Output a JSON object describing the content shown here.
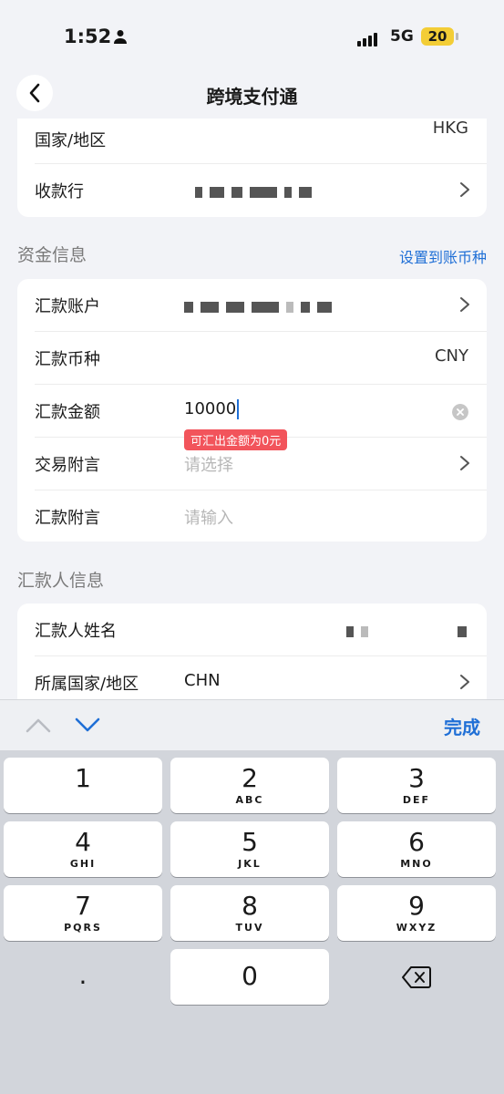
{
  "status": {
    "time": "1:52",
    "network": "5G",
    "battery": "20"
  },
  "nav": {
    "title": "跨境支付通"
  },
  "payee": {
    "country_label": "国家/地区",
    "country_value": "HKG",
    "bank_label": "收款行"
  },
  "funds": {
    "section_title": "资金信息",
    "section_link": "设置到账币种",
    "account_label": "汇款账户",
    "currency_label": "汇款币种",
    "currency_value": "CNY",
    "amount_label": "汇款金额",
    "amount_value": "10000",
    "amount_error": "可汇出金额为0元",
    "memo_label": "交易附言",
    "memo_placeholder": "请选择",
    "remark_label": "汇款附言",
    "remark_placeholder": "请输入"
  },
  "remitter": {
    "section_title": "汇款人信息",
    "name_label": "汇款人姓名",
    "country_label": "所属国家/地区",
    "country_value": "CHN"
  },
  "keyboard": {
    "done_label": "完成",
    "keys": [
      {
        "num": "1",
        "letters": ""
      },
      {
        "num": "2",
        "letters": "ABC"
      },
      {
        "num": "3",
        "letters": "DEF"
      },
      {
        "num": "4",
        "letters": "GHI"
      },
      {
        "num": "5",
        "letters": "JKL"
      },
      {
        "num": "6",
        "letters": "MNO"
      },
      {
        "num": "7",
        "letters": "PQRS"
      },
      {
        "num": "8",
        "letters": "TUV"
      },
      {
        "num": "9",
        "letters": "WXYZ"
      },
      {
        "num": ".",
        "letters": ""
      },
      {
        "num": "0",
        "letters": ""
      }
    ]
  }
}
